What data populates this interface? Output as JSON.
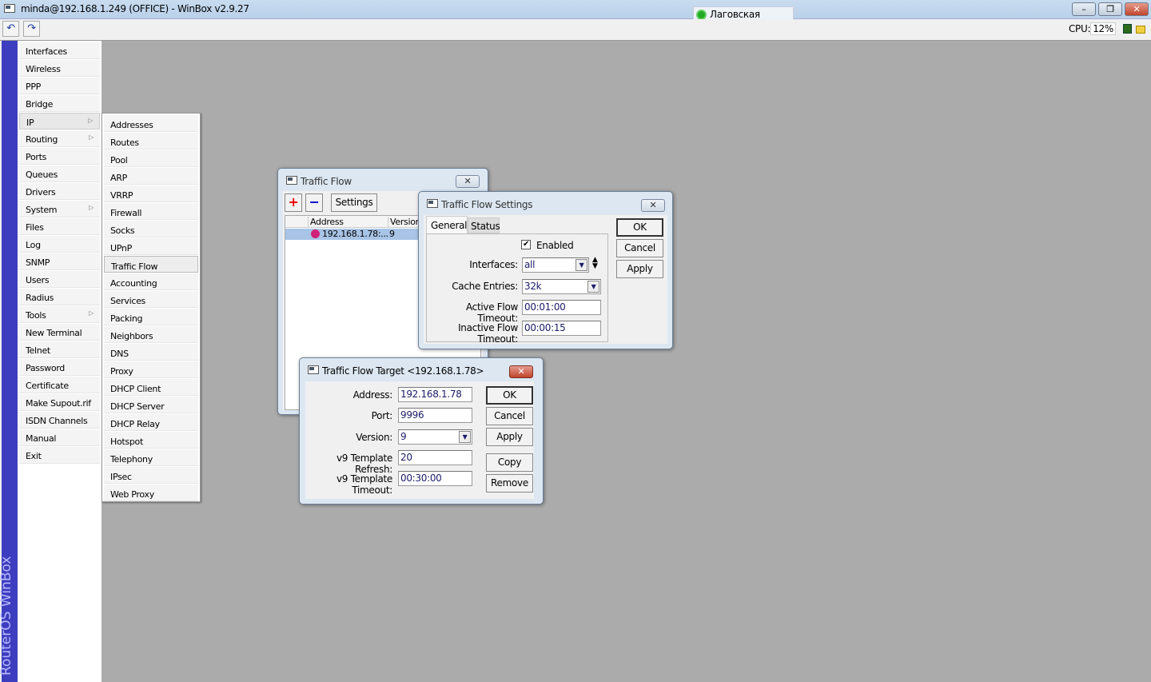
{
  "window": {
    "title": "minda@192.168.1.249 (OFFICE) - WinBox v2.9.27",
    "user": "Лаговская Галина",
    "minimize": "–",
    "restore": "❐",
    "close": "✕"
  },
  "toolbar": {
    "undo": "↶",
    "redo": "↷",
    "cpu_label": "CPU:",
    "cpu_value": "12%"
  },
  "brand": "RouterOS WinBox",
  "menu": [
    "Interfaces",
    "Wireless",
    "PPP",
    "Bridge",
    "IP",
    "Routing",
    "Ports",
    "Queues",
    "Drivers",
    "System",
    "Files",
    "Log",
    "SNMP",
    "Users",
    "Radius",
    "Tools",
    "New Terminal",
    "Telnet",
    "Password",
    "Certificate",
    "Make Supout.rif",
    "ISDN Channels",
    "Manual",
    "Exit"
  ],
  "menu_submenus": [
    "IP",
    "Routing",
    "System",
    "Tools"
  ],
  "menu_selected": "IP",
  "ip_submenu": [
    "Addresses",
    "Routes",
    "Pool",
    "ARP",
    "VRRP",
    "Firewall",
    "Socks",
    "UPnP",
    "Traffic Flow",
    "Accounting",
    "Services",
    "Packing",
    "Neighbors",
    "DNS",
    "Proxy",
    "DHCP Client",
    "DHCP Server",
    "DHCP Relay",
    "Hotspot",
    "Telephony",
    "IPsec",
    "Web Proxy"
  ],
  "ip_submenu_selected": "Traffic Flow",
  "traffic_flow": {
    "title": "Traffic Flow",
    "add": "+",
    "remove": "−",
    "settings": "Settings",
    "columns": [
      "Address",
      "Version"
    ],
    "rows": [
      {
        "address": "192.168.1.78:...",
        "version": "9"
      }
    ]
  },
  "settings": {
    "title": "Traffic Flow Settings",
    "tabs": [
      "General",
      "Status"
    ],
    "enabled_label": "Enabled",
    "enabled": true,
    "fields": [
      {
        "label": "Interfaces:",
        "value": "all"
      },
      {
        "label": "Cache Entries:",
        "value": "32k"
      },
      {
        "label": "Active Flow Timeout:",
        "value": "00:01:00"
      },
      {
        "label": "Inactive Flow Timeout:",
        "value": "00:00:15"
      }
    ],
    "buttons": [
      "OK",
      "Cancel",
      "Apply"
    ]
  },
  "target": {
    "title": "Traffic Flow Target <192.168.1.78>",
    "fields": [
      {
        "label": "Address:",
        "value": "192.168.1.78"
      },
      {
        "label": "Port:",
        "value": "9996"
      },
      {
        "label": "Version:",
        "value": "9"
      },
      {
        "label": "v9 Template Refresh:",
        "value": "20"
      },
      {
        "label": "v9 Template Timeout:",
        "value": "00:30:00"
      }
    ],
    "buttons": [
      "OK",
      "Cancel",
      "Apply",
      "Copy",
      "Remove"
    ]
  }
}
